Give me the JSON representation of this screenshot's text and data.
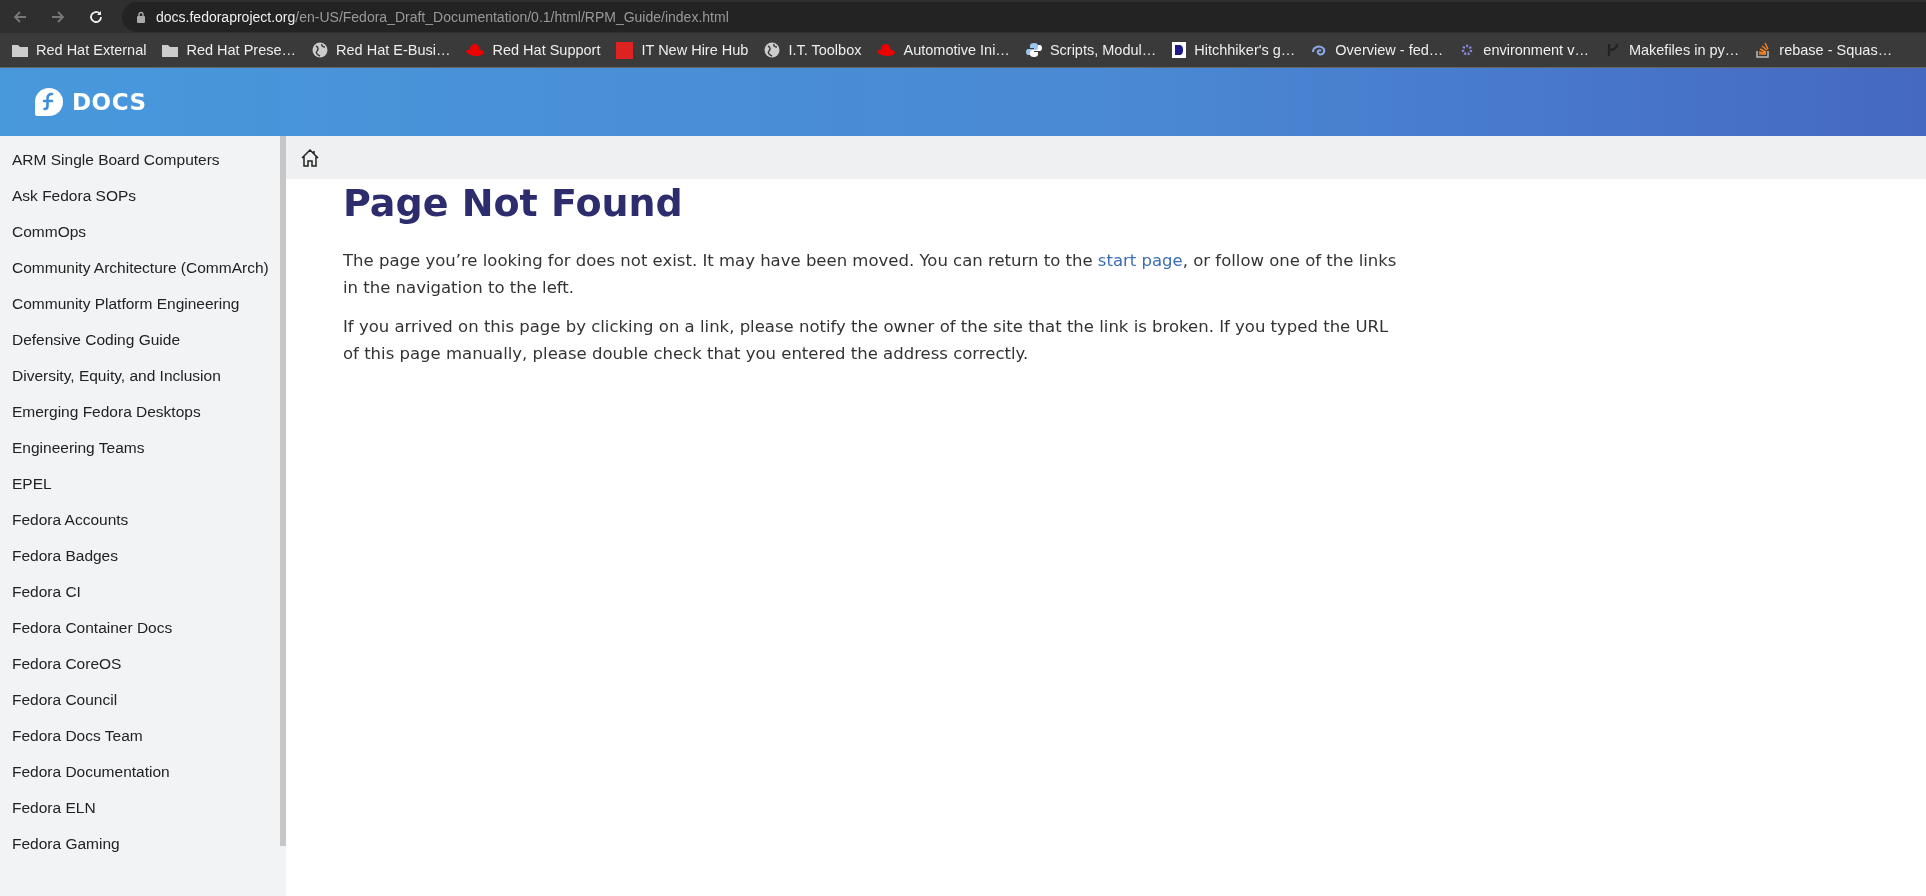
{
  "browser": {
    "url_host": "docs.fedoraproject.org",
    "url_path": "/en-US/Fedora_Draft_Documentation/0.1/html/RPM_Guide/index.html"
  },
  "bookmarks": [
    {
      "label": "Red Hat External",
      "kind": "folder"
    },
    {
      "label": "Red Hat Prese…",
      "kind": "folder"
    },
    {
      "label": "Red Hat E-Busi…",
      "kind": "globe"
    },
    {
      "label": "Red Hat Support",
      "kind": "hat"
    },
    {
      "label": "IT New Hire Hub",
      "kind": "now"
    },
    {
      "label": "I.T. Toolbox",
      "kind": "globe"
    },
    {
      "label": "Automotive Ini…",
      "kind": "hat"
    },
    {
      "label": "Scripts, Modul…",
      "kind": "python"
    },
    {
      "label": "Hitchhiker's g…",
      "kind": "d"
    },
    {
      "label": "Overview - fed…",
      "kind": "swirl"
    },
    {
      "label": "environment v…",
      "kind": "puzzle"
    },
    {
      "label": "Makefiles in py…",
      "kind": "git"
    },
    {
      "label": "rebase - Squas…",
      "kind": "stack"
    }
  ],
  "header": {
    "logo_text": "DOCS"
  },
  "sidebar": {
    "items": [
      "ARM Single Board Computers",
      "Ask Fedora SOPs",
      "CommOps",
      "Community Architecture (CommArch)",
      "Community Platform Engineering",
      "Defensive Coding Guide",
      "Diversity, Equity, and Inclusion",
      "Emerging Fedora Desktops",
      "Engineering Teams",
      "EPEL",
      "Fedora Accounts",
      "Fedora Badges",
      "Fedora CI",
      "Fedora Container Docs",
      "Fedora CoreOS",
      "Fedora Council",
      "Fedora Docs Team",
      "Fedora Documentation",
      "Fedora ELN",
      "Fedora Gaming"
    ]
  },
  "content": {
    "title": "Page Not Found",
    "paragraph_1_before": "The page you’re looking for does not exist. It may have been moved. You can return to the",
    "link": "start page",
    "paragraph_1_after": ", or follow one of the links in the navigation to the left.",
    "paragraph_2": "If you arrived on this page by clicking on a link, please notify the owner of the site that the link is broken. If you typed the URL of this page manually, please double check that you entered the address correctly."
  }
}
